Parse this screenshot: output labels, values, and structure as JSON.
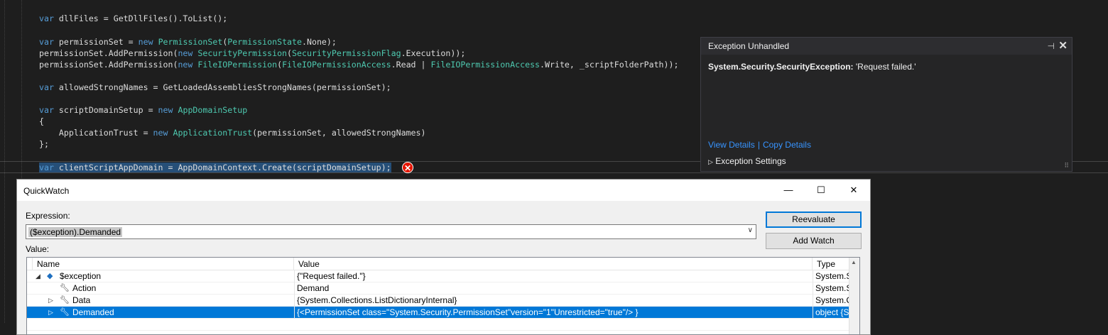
{
  "code": {
    "line1": {
      "kw": "var",
      "rest": " dllFiles = GetDllFiles().ToList();"
    },
    "line2": {
      "kw1": "var",
      "p1": " permissionSet = ",
      "kw2": "new",
      "sp": " ",
      "ty1": "PermissionSet",
      "p2": "(",
      "ty2": "PermissionState",
      "p3": ".None);"
    },
    "line3": {
      "p1": "permissionSet.AddPermission(",
      "kw": "new",
      "sp": " ",
      "ty1": "SecurityPermission",
      "p2": "(",
      "ty2": "SecurityPermissionFlag",
      "p3": ".Execution));"
    },
    "line4": {
      "p1": "permissionSet.AddPermission(",
      "kw": "new",
      "sp": " ",
      "ty1": "FileIOPermission",
      "p2": "(",
      "ty2": "FileIOPermissionAccess",
      "p3": ".Read | ",
      "ty3": "FileIOPermissionAccess",
      "p4": ".Write, _scriptFolderPath));"
    },
    "line5": {
      "kw": "var",
      "rest": " allowedStrongNames = GetLoadedAssembliesStrongNames(permissionSet);"
    },
    "line6": {
      "kw1": "var",
      "p1": " scriptDomainSetup = ",
      "kw2": "new",
      "sp": " ",
      "ty": "AppDomainSetup"
    },
    "line7": "{",
    "line8": {
      "p1": "    ApplicationTrust = ",
      "kw": "new",
      "sp": " ",
      "ty": "ApplicationTrust",
      "p2": "(permissionSet, allowedStrongNames)"
    },
    "line9": "};",
    "line10": {
      "kw": "var",
      "rest": " clientScriptAppDomain = AppDomainContext.Create(scriptDomainSetup);"
    }
  },
  "exception": {
    "title": "Exception Unhandled",
    "type": "System.Security.SecurityException:",
    "message": " 'Request failed.'",
    "view_details": "View Details",
    "separator": "|",
    "copy_details": "Copy Details",
    "settings": "Exception Settings"
  },
  "quickwatch": {
    "title": "QuickWatch",
    "expression_label": "Expression:",
    "expression": "($exception).Demanded",
    "value_label": "Value:",
    "reevaluate": "Reevaluate",
    "add_watch": "Add Watch",
    "columns": {
      "name": "Name",
      "value": "Value",
      "type": "Type"
    },
    "rows": [
      {
        "name": "$exception",
        "value": "{\"Request failed.\"}",
        "type": "System.S"
      },
      {
        "name": "Action",
        "value": "Demand",
        "type": "System.S"
      },
      {
        "name": "Data",
        "value": "{System.Collections.ListDictionaryInternal}",
        "type": "System.C"
      },
      {
        "name": "Demanded",
        "value": "{<PermissionSet class=\"System.Security.PermissionSet\"version=\"1\"Unrestricted=\"true\"/> }",
        "type": "object {S"
      }
    ]
  }
}
